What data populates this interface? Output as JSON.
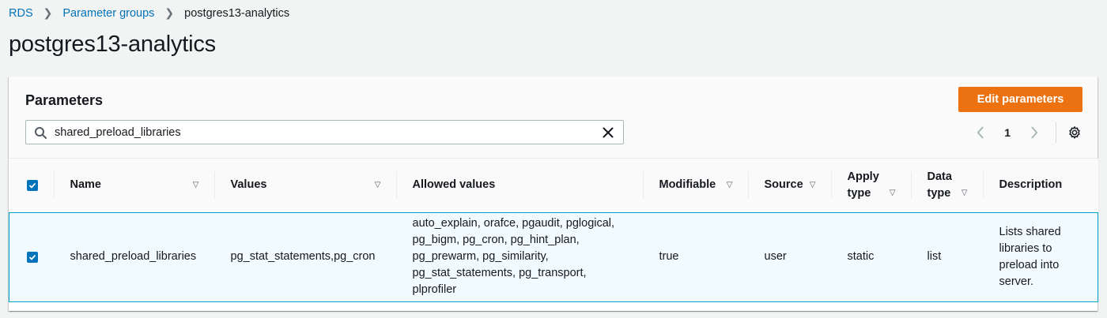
{
  "breadcrumb": {
    "items": [
      "RDS",
      "Parameter groups"
    ],
    "current": "postgres13-analytics"
  },
  "page_title": "postgres13-analytics",
  "panel": {
    "title": "Parameters",
    "edit_button": "Edit parameters",
    "search_value": "shared_preload_libraries",
    "page_number": "1"
  },
  "table": {
    "columns": [
      {
        "label": "Name",
        "sortable": true
      },
      {
        "label": "Values",
        "sortable": true
      },
      {
        "label": "Allowed values",
        "sortable": false
      },
      {
        "label": "Modifiable",
        "sortable": true
      },
      {
        "label": "Source",
        "sortable": true
      },
      {
        "label": "Apply type",
        "sortable": true
      },
      {
        "label": "Data type",
        "sortable": true
      },
      {
        "label": "Description",
        "sortable": false
      }
    ],
    "rows": [
      {
        "selected": true,
        "name": "shared_preload_libraries",
        "values": "pg_stat_statements,pg_cron",
        "allowed_values": "auto_explain, orafce, pgaudit, pglogical, pg_bigm, pg_cron, pg_hint_plan, pg_prewarm, pg_similarity, pg_stat_statements, pg_transport, plprofiler",
        "modifiable": "true",
        "source": "user",
        "apply_type": "static",
        "data_type": "list",
        "description": "Lists shared libraries to preload into server."
      }
    ]
  },
  "colors": {
    "accent_button": "#ec7211",
    "link": "#0073bb",
    "selected_row_bg": "#f1faff",
    "selected_row_border": "#00a1c9"
  },
  "icons": {
    "search": "search-icon",
    "clear": "close-icon",
    "prev_page": "chevron-left-icon",
    "next_page": "chevron-right-icon",
    "settings": "gear-icon",
    "sort": "caret-down-icon",
    "checkbox": "checkbox-checked-icon"
  }
}
